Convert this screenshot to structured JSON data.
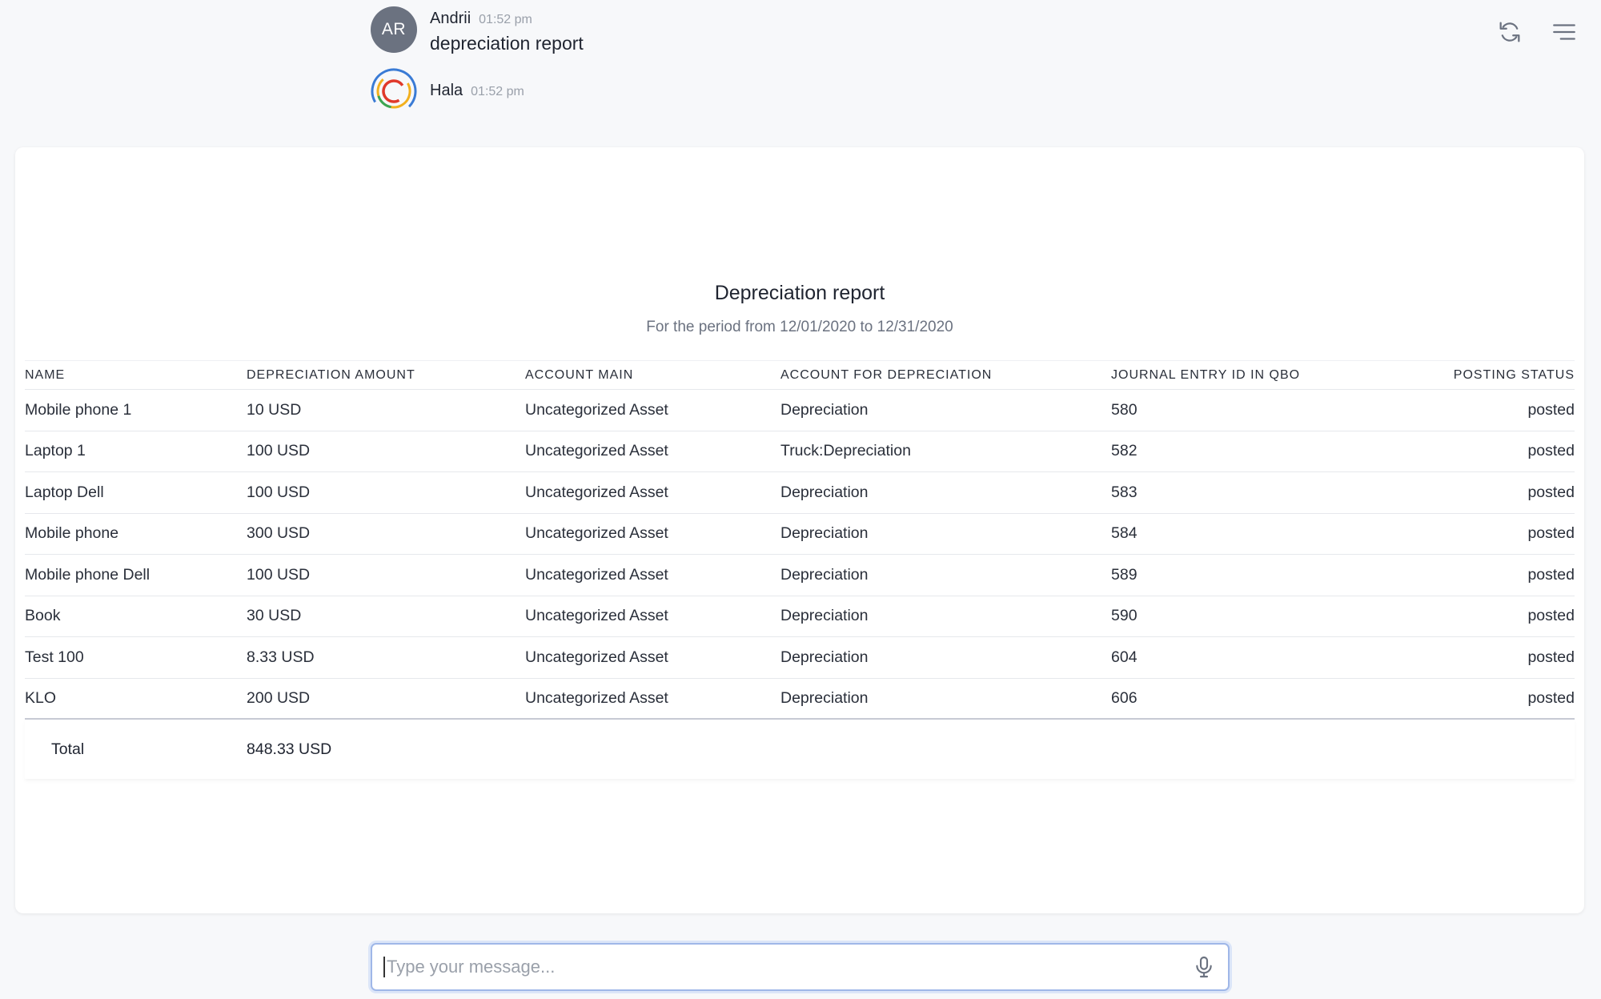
{
  "chat": {
    "messages": [
      {
        "author": "Andrii",
        "time": "01:52 pm",
        "text": "depreciation report",
        "initials": "AR"
      },
      {
        "author": "Hala",
        "time": "01:52 pm"
      }
    ]
  },
  "report": {
    "title": "Depreciation report",
    "subtitle": "For the period from 12/01/2020 to 12/31/2020",
    "columns": [
      "NAME",
      "DEPRECIATION AMOUNT",
      "ACCOUNT MAIN",
      "ACCOUNT FOR DEPRECIATION",
      "JOURNAL ENTRY ID IN QBO",
      "POSTING STATUS"
    ],
    "rows": [
      [
        "Mobile phone 1",
        "10 USD",
        "Uncategorized Asset",
        "Depreciation",
        "580",
        "posted"
      ],
      [
        "Laptop 1",
        "100 USD",
        "Uncategorized Asset",
        "Truck:Depreciation",
        "582",
        "posted"
      ],
      [
        "Laptop Dell",
        "100 USD",
        "Uncategorized Asset",
        "Depreciation",
        "583",
        "posted"
      ],
      [
        "Mobile phone",
        "300 USD",
        "Uncategorized Asset",
        "Depreciation",
        "584",
        "posted"
      ],
      [
        "Mobile phone Dell",
        "100 USD",
        "Uncategorized Asset",
        "Depreciation",
        "589",
        "posted"
      ],
      [
        "Book",
        "30 USD",
        "Uncategorized Asset",
        "Depreciation",
        "590",
        "posted"
      ],
      [
        "Test 100",
        "8.33 USD",
        "Uncategorized Asset",
        "Depreciation",
        "604",
        "posted"
      ],
      [
        "KLO",
        "200 USD",
        "Uncategorized Asset",
        "Depreciation",
        "606",
        "posted"
      ]
    ],
    "total_label": "Total",
    "total_value": "848.33 USD"
  },
  "composer": {
    "placeholder": "Type your message..."
  },
  "icons": {
    "refresh": "refresh-icon",
    "menu": "menu-icon",
    "mic": "microphone-icon"
  }
}
